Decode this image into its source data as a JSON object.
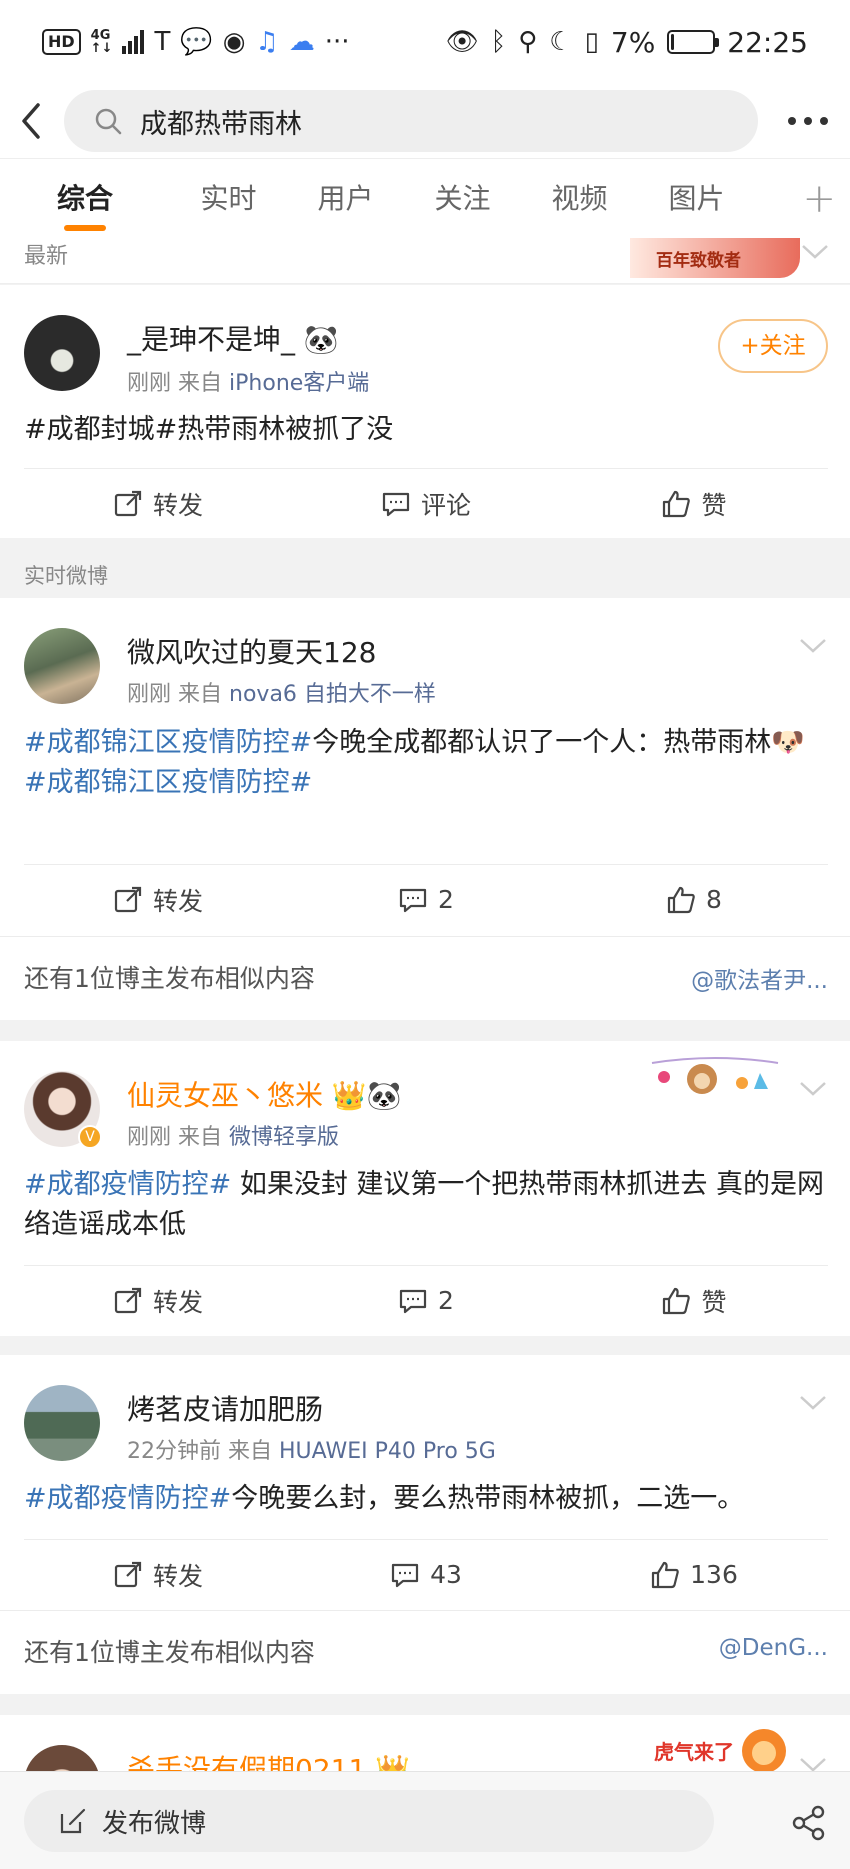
{
  "status_bar": {
    "hd": "HD",
    "network": "4G",
    "battery_percent": "7%",
    "battery_level": 0.07,
    "time": "22:25"
  },
  "search": {
    "query": "成都热带雨林"
  },
  "tabs": [
    {
      "label": "综合",
      "active": true
    },
    {
      "label": "实时"
    },
    {
      "label": "用户"
    },
    {
      "label": "关注"
    },
    {
      "label": "视频"
    },
    {
      "label": "图片"
    }
  ],
  "tab_add": "+",
  "latest": {
    "label": "最新",
    "banner_text": "百年致敬者"
  },
  "posts": [
    {
      "username": "_是珅不是坤_",
      "username_emoji": "🐼",
      "time": "刚刚",
      "from_prefix": "来自",
      "source": "iPhone客户端",
      "follow_label": "+关注",
      "content_text": "#成都封城#热带雨林被抓了没",
      "repost": "转发",
      "comment": "评论",
      "like": "赞"
    },
    {
      "username": "微风吹过的夏天128",
      "time": "刚刚",
      "from_prefix": "来自",
      "source": "nova6 自拍大不一样",
      "tag1": "#成都锦江区疫情防控#",
      "text1": "今晚全成都都认识了一个人：热带雨林🐶",
      "tag2": "#成都锦江区疫情防控#",
      "repost": "转发",
      "comment": "2",
      "like": "8",
      "similar_text": "还有1位博主发布相似内容",
      "similar_user": "@歌法者尹..."
    },
    {
      "username": "仙灵女巫丶悠米",
      "username_emoji": "👑🐼",
      "time": "刚刚",
      "from_prefix": "来自",
      "source": "微博轻享版",
      "tag1": "#成都疫情防控#",
      "text1": " 如果没封 建议第一个把热带雨林抓进去 真的是网络造谣成本低",
      "repost": "转发",
      "comment": "2",
      "like": "赞"
    },
    {
      "username": "烤茗皮请加肥肠",
      "time": "22分钟前",
      "from_prefix": "来自",
      "source": "HUAWEI P40 Pro 5G",
      "tag1": "#成都疫情防控#",
      "text1": "今晚要么封，要么热带雨林被抓，二选一。",
      "repost": "转发",
      "comment": "43",
      "like": "136",
      "similar_text": "还有1位博主发布相似内容",
      "similar_user": "@DenG..."
    },
    {
      "username": "杀手没有假期0211",
      "username_emoji": "👑",
      "decor_text": "虎气来了"
    }
  ],
  "section_realtime": "实时微博",
  "bottom": {
    "post_label": "发布微博"
  },
  "colors": {
    "accent": "#ff8200",
    "tag_blue": "#3a74b6",
    "source_blue": "#576b95"
  }
}
